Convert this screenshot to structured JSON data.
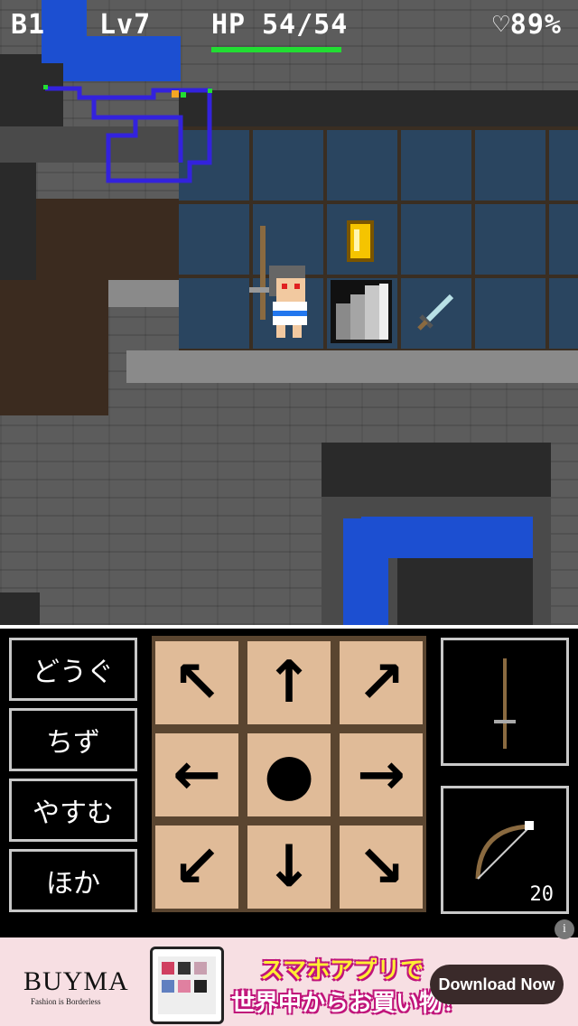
{
  "status": {
    "floor": "B1",
    "level": "Lv7",
    "hp_label": "HP",
    "hp_value": "54/54",
    "hp_fraction": 1.0,
    "satiety": "♡89%"
  },
  "commands": [
    {
      "label": "どうぐ"
    },
    {
      "label": "ちず"
    },
    {
      "label": "やすむ"
    },
    {
      "label": "ほか"
    }
  ],
  "dpad": {
    "up_left": "arrow-up-left-icon",
    "up": "arrow-up-icon",
    "up_right": "arrow-up-right-icon",
    "left": "arrow-left-icon",
    "center": "wait-dot-icon",
    "right": "arrow-right-icon",
    "down_left": "arrow-down-left-icon",
    "down": "arrow-down-icon",
    "down_right": "arrow-down-right-icon"
  },
  "equipment": {
    "weapon_icon": "staff-icon",
    "ranged_icon": "bow-icon",
    "ammo_count": "20"
  },
  "ad": {
    "brand": "BUYMA",
    "tagline": "Fashion is Borderless",
    "copy_line1": "スマホアプリで",
    "copy_line2": "世界中からお買い物！",
    "button": "Download Now",
    "info": "i"
  },
  "colors": {
    "hp_bar": "#22dd33",
    "dpad_key": "#e0bb98",
    "minimap": "#3322dd",
    "water": "#1c4fd1"
  }
}
